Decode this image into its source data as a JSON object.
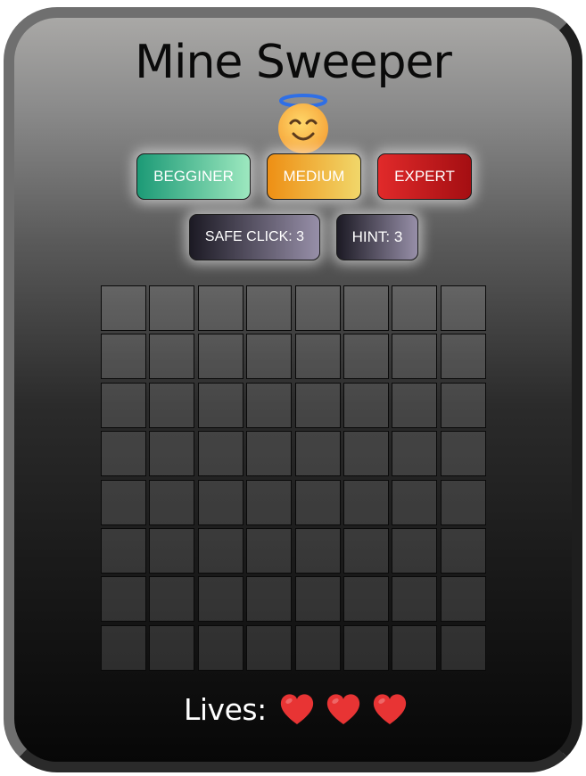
{
  "title": "Mine Sweeper",
  "status_face": "smiling-face-with-halo-icon",
  "difficulty": {
    "beginner_label": "BEGGINER",
    "medium_label": "MEDIUM",
    "expert_label": "EXPERT"
  },
  "helpers": {
    "safe_click_label": "SAFE CLICK: 3",
    "hint_label": "HINT: 3"
  },
  "board": {
    "rows": 8,
    "cols": 8,
    "cells_revealed": 0
  },
  "lives": {
    "label": "Lives:",
    "count": 3,
    "icon": "heart-icon"
  },
  "colors": {
    "beginner": "#1c9a76",
    "medium": "#ee8f14",
    "expert": "#e12a2a",
    "heart": "#e83434"
  }
}
